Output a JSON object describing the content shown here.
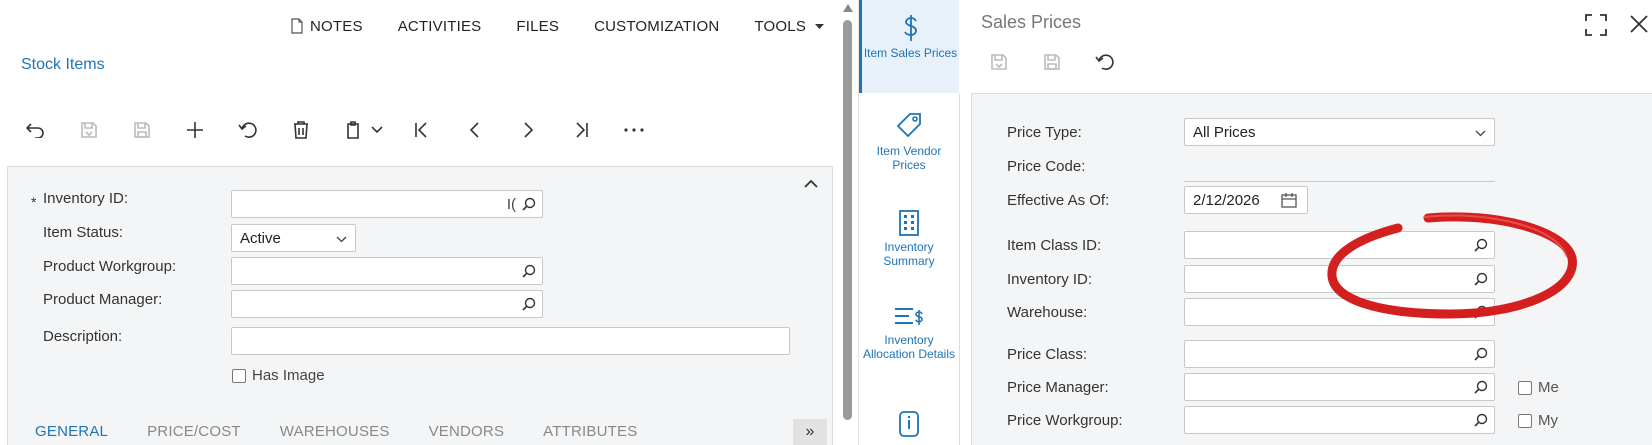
{
  "left": {
    "topnav": {
      "notes": "NOTES",
      "activities": "ACTIVITIES",
      "files": "FILES",
      "customization": "CUSTOMIZATION",
      "tools": "TOOLS"
    },
    "screen_title": "Stock Items",
    "form": {
      "inventory_id_label": "Inventory ID:",
      "inventory_id_required": "*",
      "inventory_id_value": "I(",
      "item_status_label": "Item Status:",
      "item_status_value": "Active",
      "product_workgroup_label": "Product Workgroup:",
      "product_manager_label": "Product Manager:",
      "description_label": "Description:",
      "has_image_label": "Has Image"
    },
    "tabs": [
      "GENERAL",
      "PRICE/COST",
      "WAREHOUSES",
      "VENDORS",
      "ATTRIBUTES"
    ],
    "tab_more": "»"
  },
  "right": {
    "sidenav": {
      "item_sales_prices": "Item Sales Prices",
      "item_vendor_prices": "Item Vendor Prices",
      "inventory_summary": "Inventory Summary",
      "inventory_allocation_details": "Inventory Allocation Details"
    },
    "panel_title": "Sales Prices",
    "form": {
      "price_type_label": "Price Type:",
      "price_type_value": "All Prices",
      "price_code_label": "Price Code:",
      "effective_as_of_label": "Effective As Of:",
      "effective_as_of_value": "2/12/2026",
      "item_class_id_label": "Item Class ID:",
      "inventory_id_label": "Inventory ID:",
      "warehouse_label": "Warehouse:",
      "price_class_label": "Price Class:",
      "price_manager_label": "Price Manager:",
      "price_manager_me": "Me",
      "price_workgroup_label": "Price Workgroup:",
      "price_workgroup_my": "My"
    }
  },
  "colors": {
    "accent": "#1f73b7",
    "annotation": "#d41f1f",
    "form_bg": "#f4f5f6"
  }
}
